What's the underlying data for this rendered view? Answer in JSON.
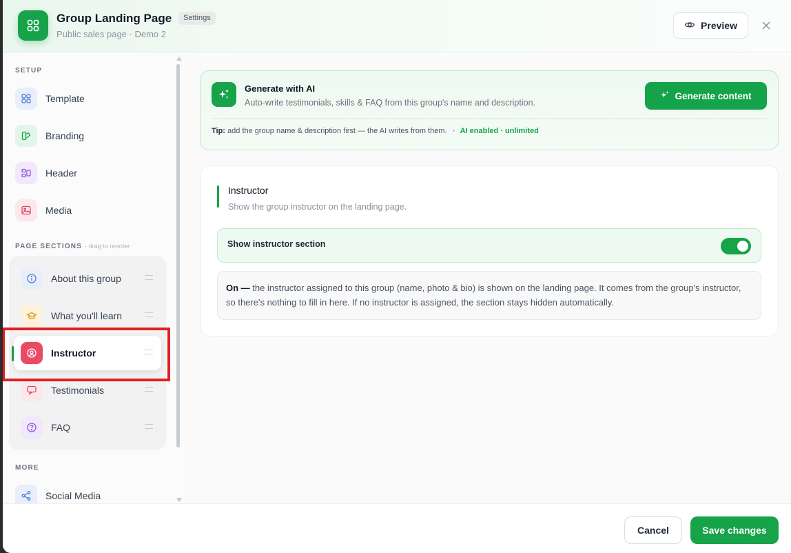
{
  "header": {
    "title": "Group Landing Page",
    "badge": "Settings",
    "subtitle": "Public sales page · Demo 2",
    "preview_label": "Preview"
  },
  "sidebar": {
    "setup_label": "SETUP",
    "setup_items": [
      {
        "label": "Template",
        "icon": "grid-icon"
      },
      {
        "label": "Branding",
        "icon": "palette-icon"
      },
      {
        "label": "Header",
        "icon": "layout-icon"
      },
      {
        "label": "Media",
        "icon": "image-icon"
      }
    ],
    "sections_label": "PAGE SECTIONS",
    "sections_hint": "· drag to reorder",
    "section_items": [
      {
        "label": "About this group",
        "icon": "info-icon"
      },
      {
        "label": "What you'll learn",
        "icon": "graduation-cap-icon"
      },
      {
        "label": "Instructor",
        "icon": "user-circle-icon",
        "active": true
      },
      {
        "label": "Testimonials",
        "icon": "chat-icon"
      },
      {
        "label": "FAQ",
        "icon": "question-icon"
      }
    ],
    "more_label": "MORE",
    "more_items": [
      {
        "label": "Social Media",
        "icon": "share-icon"
      }
    ]
  },
  "ai": {
    "title": "Generate with AI",
    "description": "Auto-write testimonials, skills & FAQ from this group's name and description.",
    "button_label": "Generate content",
    "tip_prefix": "Tip:",
    "tip_text": "add the group name & description first — the AI writes from them.",
    "status": "AI enabled · unlimited"
  },
  "instructor": {
    "title": "Instructor",
    "description": "Show the group instructor on the landing page.",
    "toggle_label": "Show instructor section",
    "toggle_on": true,
    "info_bold": "On —",
    "info_text": "the instructor assigned to this group (name, photo & bio) is shown on the landing page. It comes from the group's instructor, so there's nothing to fill in here. If no instructor is assigned, the section stays hidden automatically."
  },
  "footer": {
    "cancel_label": "Cancel",
    "save_label": "Save changes"
  },
  "colors": {
    "accent": "#16a34a",
    "highlight": "#e02020"
  }
}
